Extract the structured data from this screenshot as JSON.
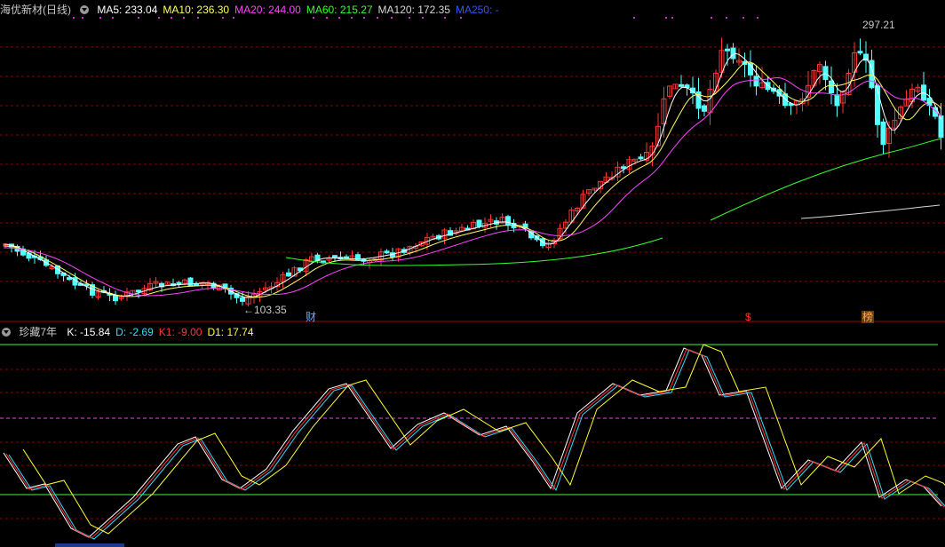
{
  "main": {
    "title": "海优新材(日线)",
    "ma": [
      {
        "label": "MA5: 233.04",
        "color": "#ffffff"
      },
      {
        "label": "MA10: 236.30",
        "color": "#ffff66"
      },
      {
        "label": "MA20: 244.00",
        "color": "#ff44ff"
      },
      {
        "label": "MA60: 215.27",
        "color": "#33ff33"
      },
      {
        "label": "MA120: 172.35",
        "color": "#d8d8d8"
      },
      {
        "label": "MA250: -",
        "color": "#3355ff"
      }
    ],
    "high_label": "297.21",
    "low_label": "←103.35",
    "tags": [
      {
        "text": "财",
        "color": "#66aaff"
      },
      {
        "text": "$",
        "color": "#ff3333"
      },
      {
        "text": "榜",
        "color": "#ffaa44"
      }
    ]
  },
  "sub": {
    "title": "珍藏7年",
    "values": [
      {
        "label": "K: -15.84",
        "color": "#ffffff"
      },
      {
        "label": "D: -2.69",
        "color": "#33ddff"
      },
      {
        "label": "K1: -9.00",
        "color": "#ff3333"
      },
      {
        "label": "D1: 17.74",
        "color": "#ffff33"
      }
    ]
  },
  "colors": {
    "up": "#ff3333",
    "down": "#54ffff",
    "grid": "#8a0000",
    "bg": "#000000"
  }
}
